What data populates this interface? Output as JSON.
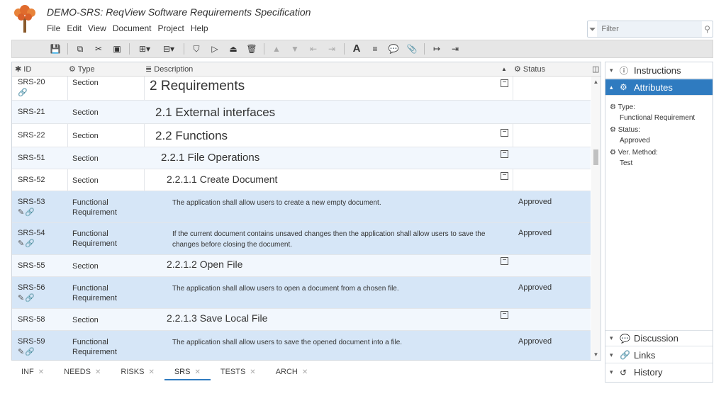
{
  "window": {
    "title": "DEMO-SRS: ReqView Software Requirements Specification"
  },
  "menu": [
    "File",
    "Edit",
    "View",
    "Document",
    "Project",
    "Help"
  ],
  "filter": {
    "placeholder": "Filter"
  },
  "columns": {
    "id": "ID",
    "type": "Type",
    "description": "Description",
    "status": "Status"
  },
  "rows": [
    {
      "id": "SRS-20",
      "type": "Section",
      "desc": "2 Requirements",
      "status": ""
    },
    {
      "id": "SRS-21",
      "type": "Section",
      "desc": "2.1 External interfaces",
      "status": ""
    },
    {
      "id": "SRS-22",
      "type": "Section",
      "desc": "2.2 Functions",
      "status": ""
    },
    {
      "id": "SRS-51",
      "type": "Section",
      "desc": "2.2.1 File Operations",
      "status": ""
    },
    {
      "id": "SRS-52",
      "type": "Section",
      "desc": "2.2.1.1 Create Document",
      "status": ""
    },
    {
      "id": "SRS-53",
      "type": "Functional Requirement",
      "desc": "The application shall allow users to create a new empty document.",
      "status": "Approved"
    },
    {
      "id": "SRS-54",
      "type": "Functional Requirement",
      "desc": "If the current document contains unsaved changes then the application shall allow users to save the changes before closing the document.",
      "status": "Approved"
    },
    {
      "id": "SRS-55",
      "type": "Section",
      "desc": "2.2.1.2 Open File",
      "status": ""
    },
    {
      "id": "SRS-56",
      "type": "Functional Requirement",
      "desc": "The application shall allow users to open a document from a chosen file.",
      "status": "Approved"
    },
    {
      "id": "SRS-58",
      "type": "Section",
      "desc": "2.2.1.3 Save Local File",
      "status": ""
    },
    {
      "id": "SRS-59",
      "type": "Functional Requirement",
      "desc": "The application shall allow users to save the opened document into a file.",
      "status": "Approved"
    }
  ],
  "panel": {
    "instructions": "Instructions",
    "attributes": "Attributes",
    "attrs": [
      {
        "label": "Type:",
        "value": "Functional Requirement"
      },
      {
        "label": "Status:",
        "value": "Approved"
      },
      {
        "label": "Ver. Method:",
        "value": "Test"
      }
    ],
    "discussion": "Discussion",
    "links": "Links",
    "history": "History"
  },
  "tabs": [
    "INF",
    "NEEDS",
    "RISKS",
    "SRS",
    "TESTS",
    "ARCH"
  ],
  "active_tab": "SRS",
  "colors": {
    "accent": "#2f7bc0",
    "selected_row": "#d6e6f7"
  },
  "icons": {
    "toolbar": [
      "save-icon",
      "copy-icon",
      "cut-icon",
      "paste-icon",
      "insert-icon",
      "delete-icon",
      "move-up-icon",
      "move-down-icon",
      "indent-icon",
      "outdent-icon",
      "text-format-icon",
      "comment-icon",
      "attachment-icon",
      "link-icon"
    ]
  }
}
